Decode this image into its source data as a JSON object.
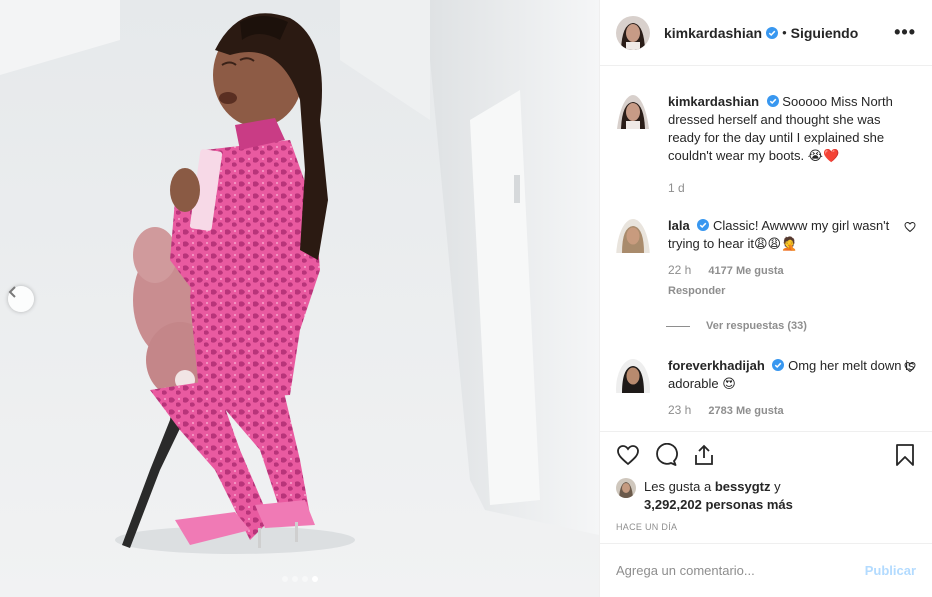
{
  "header": {
    "username": "kimkardashian",
    "follow_label": "Siguiendo",
    "more_label": "•••"
  },
  "caption": {
    "username": "kimkardashian",
    "text": "Sooooo Miss North dressed herself and thought she was ready for the day until I explained she couldn't wear my boots. 😭❤️",
    "time": "1 d"
  },
  "comments": [
    {
      "username": "lala",
      "text": "Classic! Awwww my girl wasn't trying to hear it😩😩🤦",
      "time": "22 h",
      "likes": "4177 Me gusta",
      "reply_label": "Responder"
    },
    {
      "username": "foreverkhadijah",
      "text": "Omg her melt down is adorable 😍",
      "time": "23 h",
      "likes": "2783 Me gusta"
    }
  ],
  "view_replies": "Ver respuestas (33)",
  "likes": {
    "prefix": "Les gusta a ",
    "user": "bessygtz",
    "connector": " y",
    "count": "3,292,202 personas más"
  },
  "timestamp": "Hace un día",
  "comment_box": {
    "placeholder": "Agrega un comentario...",
    "post_label": "Publicar"
  },
  "carousel": {
    "total": 4,
    "active_index": 3
  },
  "colors": {
    "verified": "#3897f0",
    "outfit_pink": "#e8559b",
    "muted": "#8e8e8e"
  }
}
